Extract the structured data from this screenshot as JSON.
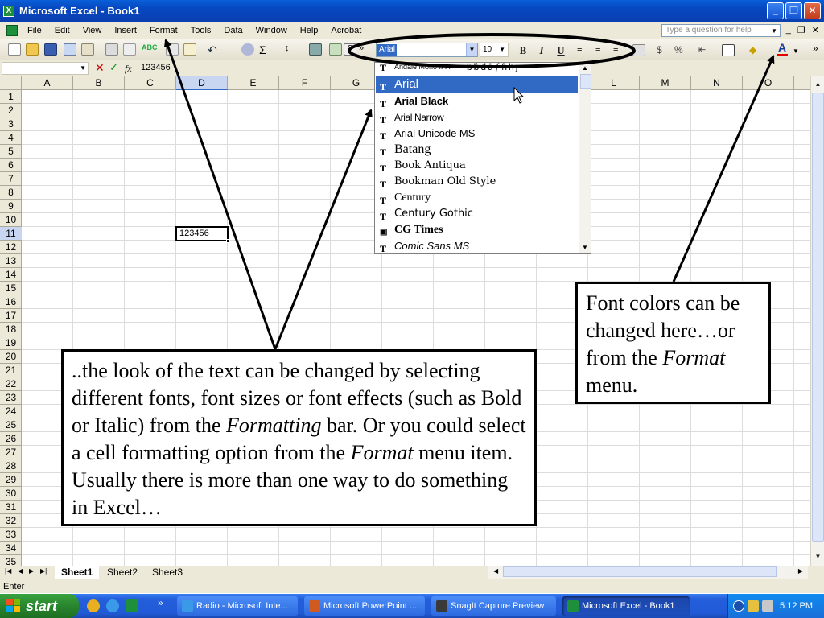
{
  "window": {
    "title": "Microsoft Excel - Book1",
    "controls": [
      "minimize-icon",
      "maximize-icon",
      "close-icon"
    ]
  },
  "menubar": {
    "items": [
      "File",
      "Edit",
      "View",
      "Insert",
      "Format",
      "Tools",
      "Data",
      "Window",
      "Help",
      "Acrobat"
    ],
    "help_placeholder": "Type a question for help"
  },
  "toolbar": {
    "font_name": "Arial",
    "font_size": "10",
    "bold": "B",
    "italic": "I",
    "underline": "U",
    "font_color_glyph": "A"
  },
  "formula_bar": {
    "cancel": "✕",
    "enter": "✓",
    "fx": "fx",
    "value": "123456"
  },
  "grid": {
    "columns": [
      "A",
      "B",
      "C",
      "D",
      "E",
      "F",
      "G",
      "H",
      "I",
      "J",
      "K",
      "L",
      "M",
      "N",
      "O"
    ],
    "rows": [
      "1",
      "2",
      "3",
      "4",
      "5",
      "6",
      "7",
      "8",
      "9",
      "10",
      "11",
      "12",
      "13",
      "14",
      "15",
      "16",
      "17",
      "18",
      "19",
      "20",
      "21",
      "22",
      "23",
      "24",
      "25",
      "26",
      "27",
      "28",
      "29",
      "30",
      "31",
      "32",
      "33",
      "34",
      "35"
    ],
    "selected_column": "D",
    "selected_row": "11",
    "active_cell_value": "123456"
  },
  "font_dropdown": {
    "fonts": [
      "Andale Mono IPA",
      "Arial",
      "Arial Black",
      "Arial Narrow",
      "Arial Unicode MS",
      "Batang",
      "Book Antiqua",
      "Bookman Old Style",
      "Century",
      "Century Gothic",
      "CG Times",
      "Comic Sans MS"
    ],
    "partial_font_suffix": "ƀḃđḋƒɦḣȷ",
    "selected": "Arial"
  },
  "sheets": {
    "tabs": [
      "Sheet1",
      "Sheet2",
      "Sheet3"
    ],
    "active": "Sheet1"
  },
  "status": {
    "mode": "Enter"
  },
  "taskbar": {
    "start_label": "start",
    "buttons": [
      "Radio - Microsoft Inte...",
      "Microsoft PowerPoint ...",
      "SnagIt Capture Preview",
      "Microsoft Excel - Book1"
    ],
    "active_button": "Microsoft Excel - Book1",
    "chevron": "»",
    "clock": "5:12 PM"
  },
  "callouts": {
    "main": {
      "p1": "..the look of the text can be changed by selecting different fonts, font sizes or font effects (such as Bold or Italic) from the ",
      "em1": "Formatting",
      "p2": " bar.  Or you could select a cell formatting option from the ",
      "em2": "Format",
      "p3": " menu item. Usually there is more than one way to do something in Excel…"
    },
    "color": {
      "p1": "Font colors can be changed here…or from the ",
      "em1": "Format",
      "p2": " menu."
    }
  },
  "colors": {
    "titlebar": "#0a5fd8",
    "selection": "#316ac5",
    "start_green": "#2b8a30",
    "font_color_bar": "#e00000"
  }
}
